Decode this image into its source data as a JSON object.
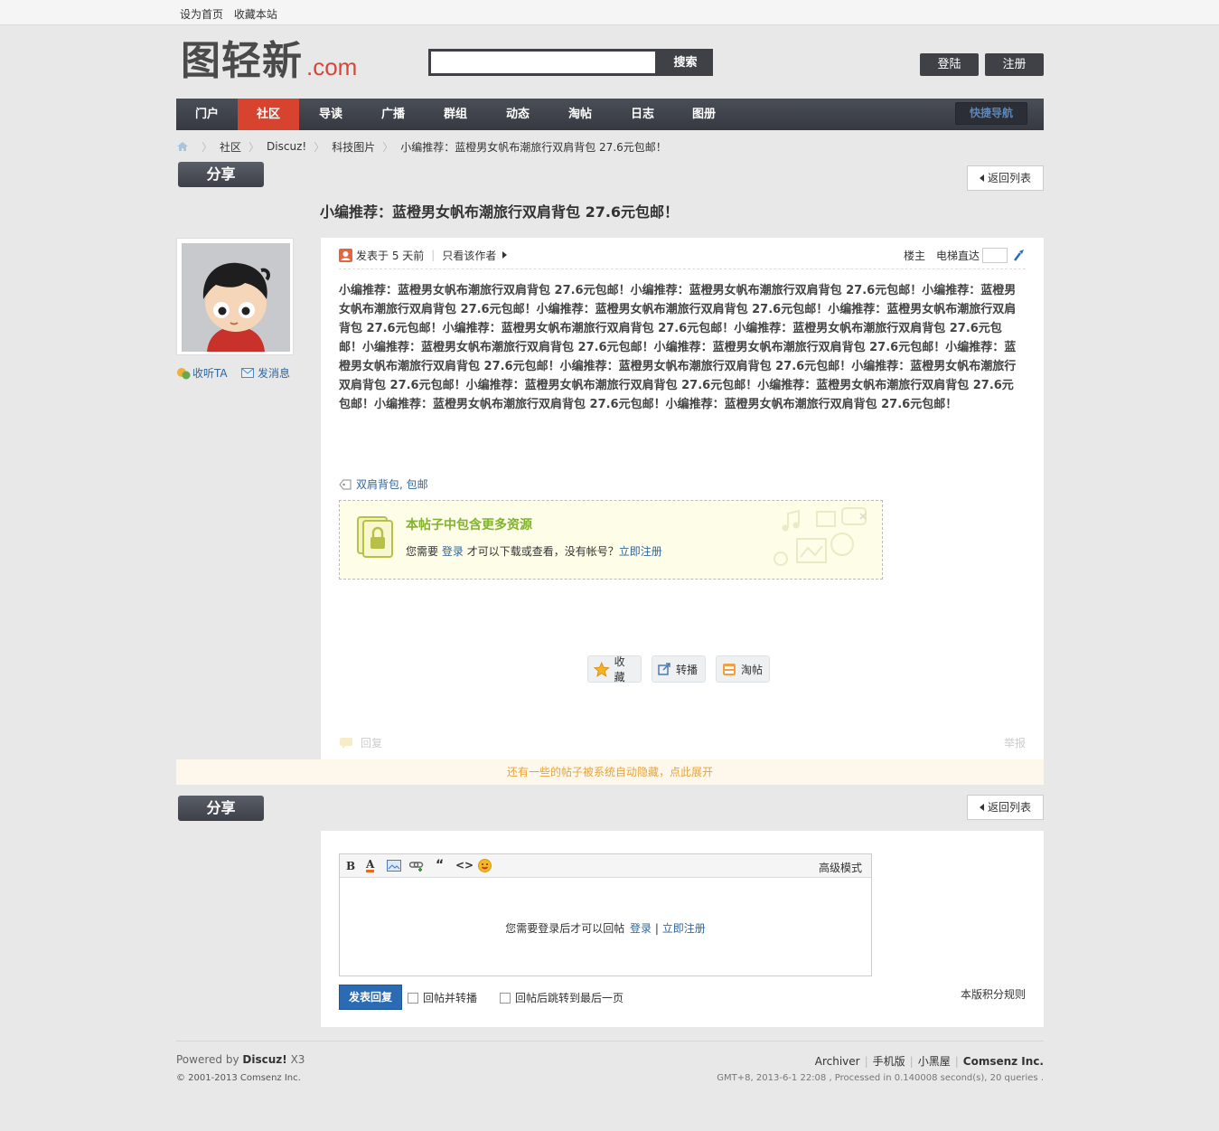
{
  "topbar": {
    "set_home": "设为首页",
    "bookmark": "收藏本站"
  },
  "logo": {
    "cn": "图轻新",
    "en": ".com"
  },
  "search": {
    "button": "搜索",
    "value": ""
  },
  "header": {
    "login": "登陆",
    "register": "注册"
  },
  "nav": {
    "items": [
      "门户",
      "社区",
      "导读",
      "广播",
      "群组",
      "动态",
      "淘帖",
      "日志",
      "图册"
    ],
    "active_index": 1,
    "quick": "快捷导航"
  },
  "breadcrumb": [
    "社区",
    "Discuz!",
    "科技图片",
    "小编推荐：蓝橙男女帆布潮旅行双肩背包 27.6元包邮！"
  ],
  "share": "分享",
  "back_list": "返回列表",
  "title": "小编推荐：蓝橙男女帆布潮旅行双肩背包 27.6元包邮！",
  "user": {
    "follow": "收听TA",
    "message": "发消息"
  },
  "post": {
    "posted": "发表于 5 天前",
    "only_author": "只看该作者",
    "floor": "楼主",
    "elevator": "电梯直达",
    "content": "小编推荐：蓝橙男女帆布潮旅行双肩背包 27.6元包邮！小编推荐：蓝橙男女帆布潮旅行双肩背包 27.6元包邮！小编推荐：蓝橙男女帆布潮旅行双肩背包 27.6元包邮！小编推荐：蓝橙男女帆布潮旅行双肩背包 27.6元包邮！小编推荐：蓝橙男女帆布潮旅行双肩背包 27.6元包邮！小编推荐：蓝橙男女帆布潮旅行双肩背包 27.6元包邮！小编推荐：蓝橙男女帆布潮旅行双肩背包 27.6元包邮！小编推荐：蓝橙男女帆布潮旅行双肩背包 27.6元包邮！小编推荐：蓝橙男女帆布潮旅行双肩背包 27.6元包邮！小编推荐：蓝橙男女帆布潮旅行双肩背包 27.6元包邮！小编推荐：蓝橙男女帆布潮旅行双肩背包 27.6元包邮！小编推荐：蓝橙男女帆布潮旅行双肩背包 27.6元包邮！小编推荐：蓝橙男女帆布潮旅行双肩背包 27.6元包邮！小编推荐：蓝橙男女帆布潮旅行双肩背包 27.6元包邮！小编推荐：蓝橙男女帆布潮旅行双肩背包 27.6元包邮！小编推荐：蓝橙男女帆布潮旅行双肩背包 27.6元包邮！",
    "tags": "双肩背包, 包邮",
    "locked_title": "本帖子中包含更多资源",
    "locked_need": "您需要",
    "locked_login": "登录",
    "locked_mid": "才可以下载或查看，没有帐号？",
    "locked_register": "立即注册",
    "btn_fav": "收藏",
    "btn_share": "转播",
    "btn_tao": "淘帖",
    "reply": "回复",
    "report": "举报"
  },
  "hidden_notice": "还有一些的帖子被系统自动隐藏，点此展开",
  "reply_box": {
    "advanced": "高级模式",
    "need_login": "您需要登录后才可以回帖",
    "login": "登录",
    "register": "立即注册",
    "submit": "发表回复",
    "chk_forward": "回帖并转播",
    "chk_last": "回帖后跳转到最后一页",
    "rules": "本版积分规则"
  },
  "footer": {
    "powered_pre": "Powered by",
    "powered_brand": "Discuz!",
    "powered_ver": "X3",
    "copyright": "© 2001-2013 Comsenz Inc.",
    "links": [
      "Archiver",
      "手机版",
      "小黑屋"
    ],
    "company": "Comsenz Inc.",
    "stats": "GMT+8, 2013-6-1 22:08 , Processed in 0.140008 second(s), 20 queries ."
  },
  "colors": {
    "nav_active": "#d8432f",
    "link": "#336699",
    "accent_green": "#82b230",
    "notice": "#e8a43a",
    "primary": "#2a6bb4"
  }
}
